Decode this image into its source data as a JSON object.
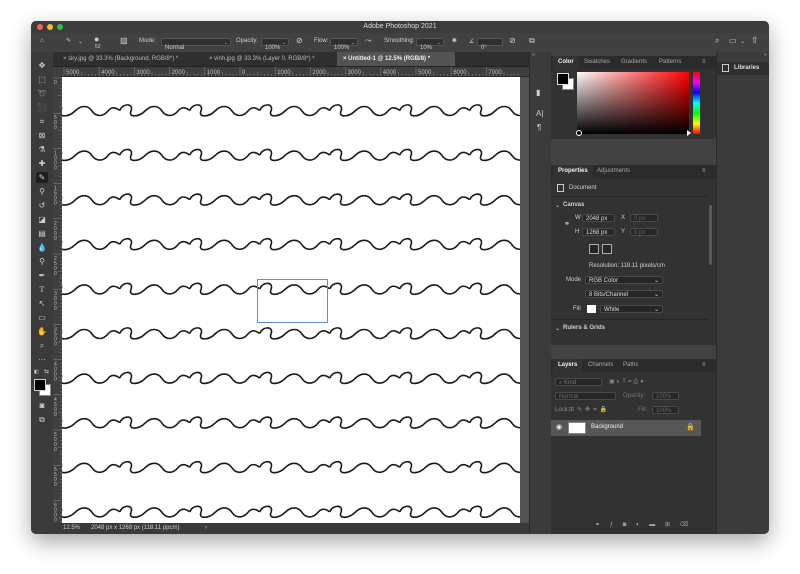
{
  "app": {
    "title": "Adobe Photoshop 2021",
    "traffic_colors": [
      "#fe5f57",
      "#febc2e",
      "#28c840"
    ]
  },
  "options_bar": {
    "brush_size": "52",
    "mode_label": "Mode:",
    "mode_value": "Normal",
    "opacity_label": "Opacity:",
    "opacity_value": "100%",
    "flow_label": "Flow:",
    "flow_value": "100%",
    "smoothing_label": "Smoothing:",
    "smoothing_value": "10%",
    "angle_value": "0°"
  },
  "tabs": [
    {
      "label": "sky.jpg @ 33.3% (Background, RGB/8*) *",
      "active": false
    },
    {
      "label": "vinh.jpg @ 33.3% (Layer 0, RGB/8*) *",
      "active": false
    },
    {
      "label": "Untitled-1 @ 12.5% (RGB/8) *",
      "active": true
    }
  ],
  "ruler": {
    "h_labels": [
      "5000",
      "4000",
      "3000",
      "2000",
      "1000",
      "0",
      "1000",
      "2000",
      "3000",
      "4000",
      "5000",
      "6000",
      "7000"
    ],
    "v_labels": [
      "0",
      "500",
      "1000",
      "1500",
      "2000",
      "2500",
      "3000",
      "3500",
      "4000",
      "4500",
      "5000",
      "5500",
      "6000"
    ]
  },
  "status": {
    "zoom": "12.5%",
    "doc_info": "2048 px x 1268 px (118.11 ppcm)",
    "arrow": "›"
  },
  "color_panel": {
    "tabs": [
      "Color",
      "Swatches",
      "Gradients",
      "Patterns"
    ],
    "foreground": "#000000",
    "background": "#ffffff",
    "hue": "#ff0000"
  },
  "properties_panel": {
    "tabs": [
      "Properties",
      "Adjustments"
    ],
    "document_label": "Document",
    "canvas_section": "Canvas",
    "w_label": "W",
    "w_value": "2048 px",
    "x_label": "X",
    "x_value": "0 px",
    "h_label": "H",
    "h_value": "1268 px",
    "y_label": "Y",
    "y_value": "0 px",
    "resolution": "Resolution: 118.11 pixels/cm",
    "mode_label": "Mode",
    "mode_value": "RGB Color",
    "bits_value": "8 Bits/Channel",
    "fill_label": "Fill",
    "fill_value": "White",
    "rulers_section": "Rulers & Grids"
  },
  "layers_panel": {
    "tabs": [
      "Layers",
      "Channels",
      "Paths"
    ],
    "kind_placeholder": "Kind",
    "blend_value": "Normal",
    "opacity_label": "Opacity:",
    "opacity_value": "100%",
    "lock_label": "Lock:",
    "fill_label": "Fill:",
    "fill_value": "100%",
    "layer_name": "Background"
  },
  "libraries": {
    "label": "Libraries"
  },
  "canvas": {
    "stroke_color": "#1a1a1a",
    "selection_color": "#5c8fd6"
  }
}
